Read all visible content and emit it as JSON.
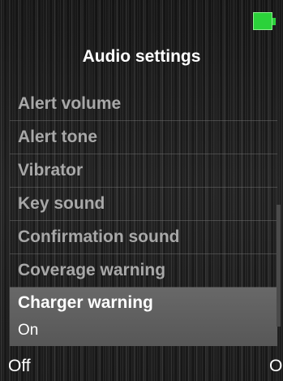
{
  "status_bar": {
    "battery_icon": "battery-full-icon",
    "battery_color": "#2bd23a"
  },
  "header": {
    "title": "Audio settings"
  },
  "menu": {
    "items": [
      {
        "label": "Alert volume"
      },
      {
        "label": "Alert tone"
      },
      {
        "label": "Vibrator"
      },
      {
        "label": "Key sound"
      },
      {
        "label": "Confirmation sound"
      },
      {
        "label": "Coverage warning"
      },
      {
        "label": "Charger warning",
        "value": "On",
        "selected": true
      }
    ]
  },
  "softkeys": {
    "left": "Off",
    "right": "On"
  }
}
